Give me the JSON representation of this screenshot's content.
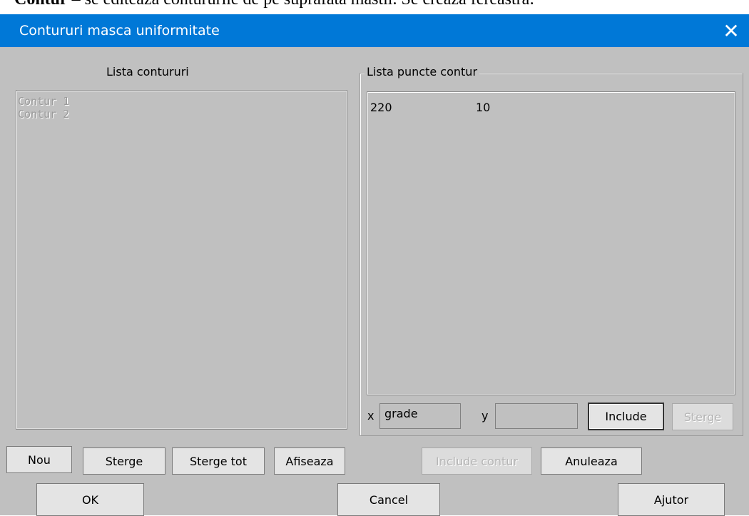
{
  "document": {
    "bold_word": "Contur",
    "rest": " – se editeaza contururile de pe suprafata mastii. Se creaza fereastra:"
  },
  "dialog": {
    "title": "Contururi masca uniformitate",
    "close_glyph": "✕",
    "left_list": {
      "caption": "Lista contururi",
      "items": [
        "Contur 1",
        "Contur 2"
      ]
    },
    "right_group": {
      "caption": "Lista puncte contur",
      "points": [
        {
          "x": "220",
          "y": "10"
        }
      ],
      "x_label": "x",
      "x_value": "grade",
      "y_label": "y",
      "y_value": "",
      "include_label": "Include",
      "sterge_label": "Sterge"
    },
    "left_buttons": {
      "nou": "Nou",
      "sterge": "Sterge",
      "sterge_tot": "Sterge tot",
      "afiseaza": "Afiseaza"
    },
    "right_buttons": {
      "include_contur": "Include contur",
      "anuleaza": "Anuleaza"
    },
    "bottom_buttons": {
      "ok": "OK",
      "cancel": "Cancel",
      "ajutor": "Ajutor"
    }
  }
}
